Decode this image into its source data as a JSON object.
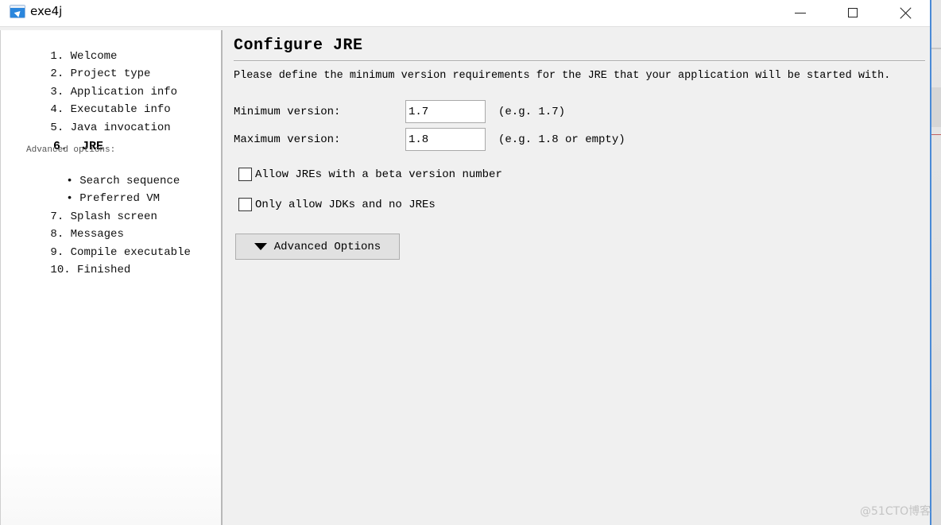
{
  "window": {
    "title": "exe4j",
    "icon": "exe4j-rocket-icon",
    "controls": {
      "minimize": "minimize-icon",
      "maximize": "maximize-icon",
      "close": "close-icon"
    }
  },
  "sidebar": {
    "steps": [
      {
        "num": "1.",
        "label": "Welcome"
      },
      {
        "num": "2.",
        "label": "Project type"
      },
      {
        "num": "3.",
        "label": "Application info"
      },
      {
        "num": "4.",
        "label": "Executable info"
      },
      {
        "num": "5.",
        "label": "Java invocation"
      },
      {
        "num": "6.",
        "label": "JRE",
        "active": true
      },
      {
        "num": "7.",
        "label": "Splash screen"
      },
      {
        "num": "8.",
        "label": "Messages"
      },
      {
        "num": "9.",
        "label": "Compile executable"
      },
      {
        "num": "10.",
        "label": "Finished"
      }
    ],
    "advanced_label": "Advanced options:",
    "sub_steps": [
      {
        "bullet": "•",
        "label": "Search sequence"
      },
      {
        "bullet": "•",
        "label": "Preferred VM"
      }
    ]
  },
  "main": {
    "title": "Configure JRE",
    "description": "Please define the minimum version requirements for the JRE that your application will be started with.",
    "fields": {
      "min_version": {
        "label": "Minimum version:",
        "value": "1.7",
        "hint": "(e.g. 1.7)"
      },
      "max_version": {
        "label": "Maximum version:",
        "value": "1.8",
        "hint": "(e.g. 1.8 or empty)"
      }
    },
    "checkboxes": [
      {
        "label": "Allow JREs with a beta version number",
        "checked": false
      },
      {
        "label": "Only allow JDKs and no JREs",
        "checked": false
      }
    ],
    "advanced_button": {
      "label": "Advanced Options",
      "icon": "triangle-down-icon"
    }
  },
  "watermark": "@51CTO博客"
}
